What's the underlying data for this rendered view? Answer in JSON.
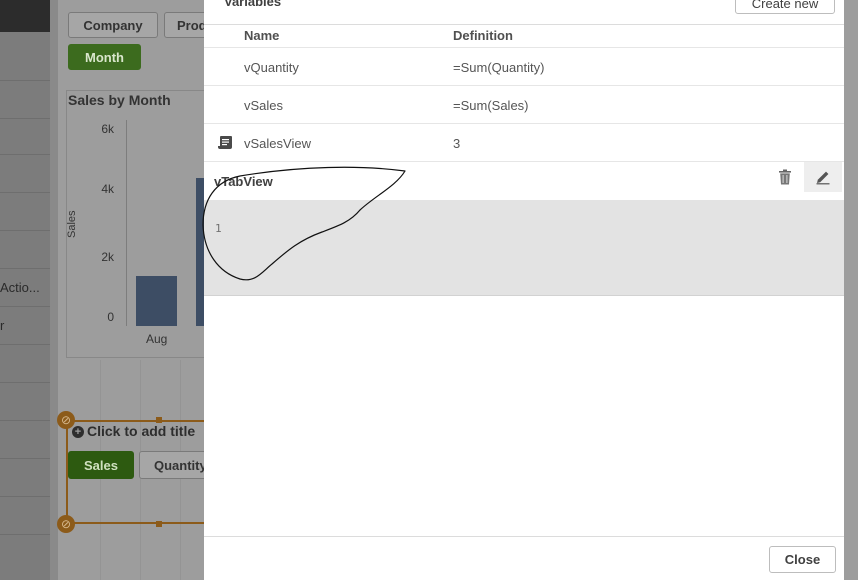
{
  "background_app": {
    "left_panel_items": [
      "Actio...",
      "r"
    ],
    "filter_buttons": [
      "Company",
      "Prod",
      "Month"
    ],
    "chart": {
      "title": "Sales by Month",
      "y_label": "Sales",
      "y_ticks": [
        "6k",
        "4k",
        "2k",
        "0"
      ],
      "x_ticks": [
        "Aug"
      ]
    },
    "add_title_placeholder": "Click to add title",
    "measure_buttons": [
      "Sales",
      "Quantity"
    ]
  },
  "dialog": {
    "title": "Variables",
    "create_new_label": "Create new",
    "columns": {
      "name": "Name",
      "definition": "Definition"
    },
    "rows": [
      {
        "name": "vQuantity",
        "definition": "=Sum(Quantity)",
        "icon": ""
      },
      {
        "name": "vSales",
        "definition": "=Sum(Sales)",
        "icon": ""
      },
      {
        "name": "vSalesView",
        "definition": "3",
        "icon": "script-icon"
      }
    ],
    "expanded": {
      "name": "vTabView",
      "line_number": "1",
      "delete_icon": "trash-icon",
      "edit_icon": "pencil-icon"
    },
    "close_label": "Close"
  }
}
